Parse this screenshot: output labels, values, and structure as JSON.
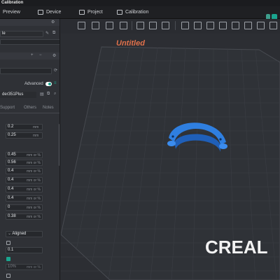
{
  "window": {
    "title": "Calibration"
  },
  "tabs": [
    {
      "label": "Preview"
    },
    {
      "label": "Device"
    },
    {
      "label": "Project"
    },
    {
      "label": "Calibration"
    }
  ],
  "left_panel": {
    "filament_label": "le",
    "advanced_label": "Advanced",
    "advanced_on": true,
    "printer_name": "der351Plus",
    "subtabs": [
      "Support",
      "Others",
      "Notes"
    ],
    "values_a": [
      {
        "value": "0.2",
        "unit": "mm"
      },
      {
        "value": "0.25",
        "unit": "mm"
      }
    ],
    "values_b": [
      {
        "value": "0.45",
        "unit": "mm or %"
      },
      {
        "value": "0.56",
        "unit": "mm or %"
      },
      {
        "value": "0.4",
        "unit": "mm or %"
      },
      {
        "value": "0.4",
        "unit": "mm or %"
      },
      {
        "value": "0.4",
        "unit": "mm or %"
      },
      {
        "value": "0.4",
        "unit": "mm or %"
      },
      {
        "value": "0",
        "unit": "mm or %"
      },
      {
        "value": "0.38",
        "unit": "mm or %"
      }
    ],
    "seam_option": "Aligned",
    "after_seam_value": "0.1",
    "percent_value": "10%",
    "percent_unit": "mm or %"
  },
  "viewport": {
    "plate_name": "Untitled",
    "bed_brand": "CREAL",
    "accent_color": "#e0714b",
    "object_color": "#2f7fe0"
  }
}
